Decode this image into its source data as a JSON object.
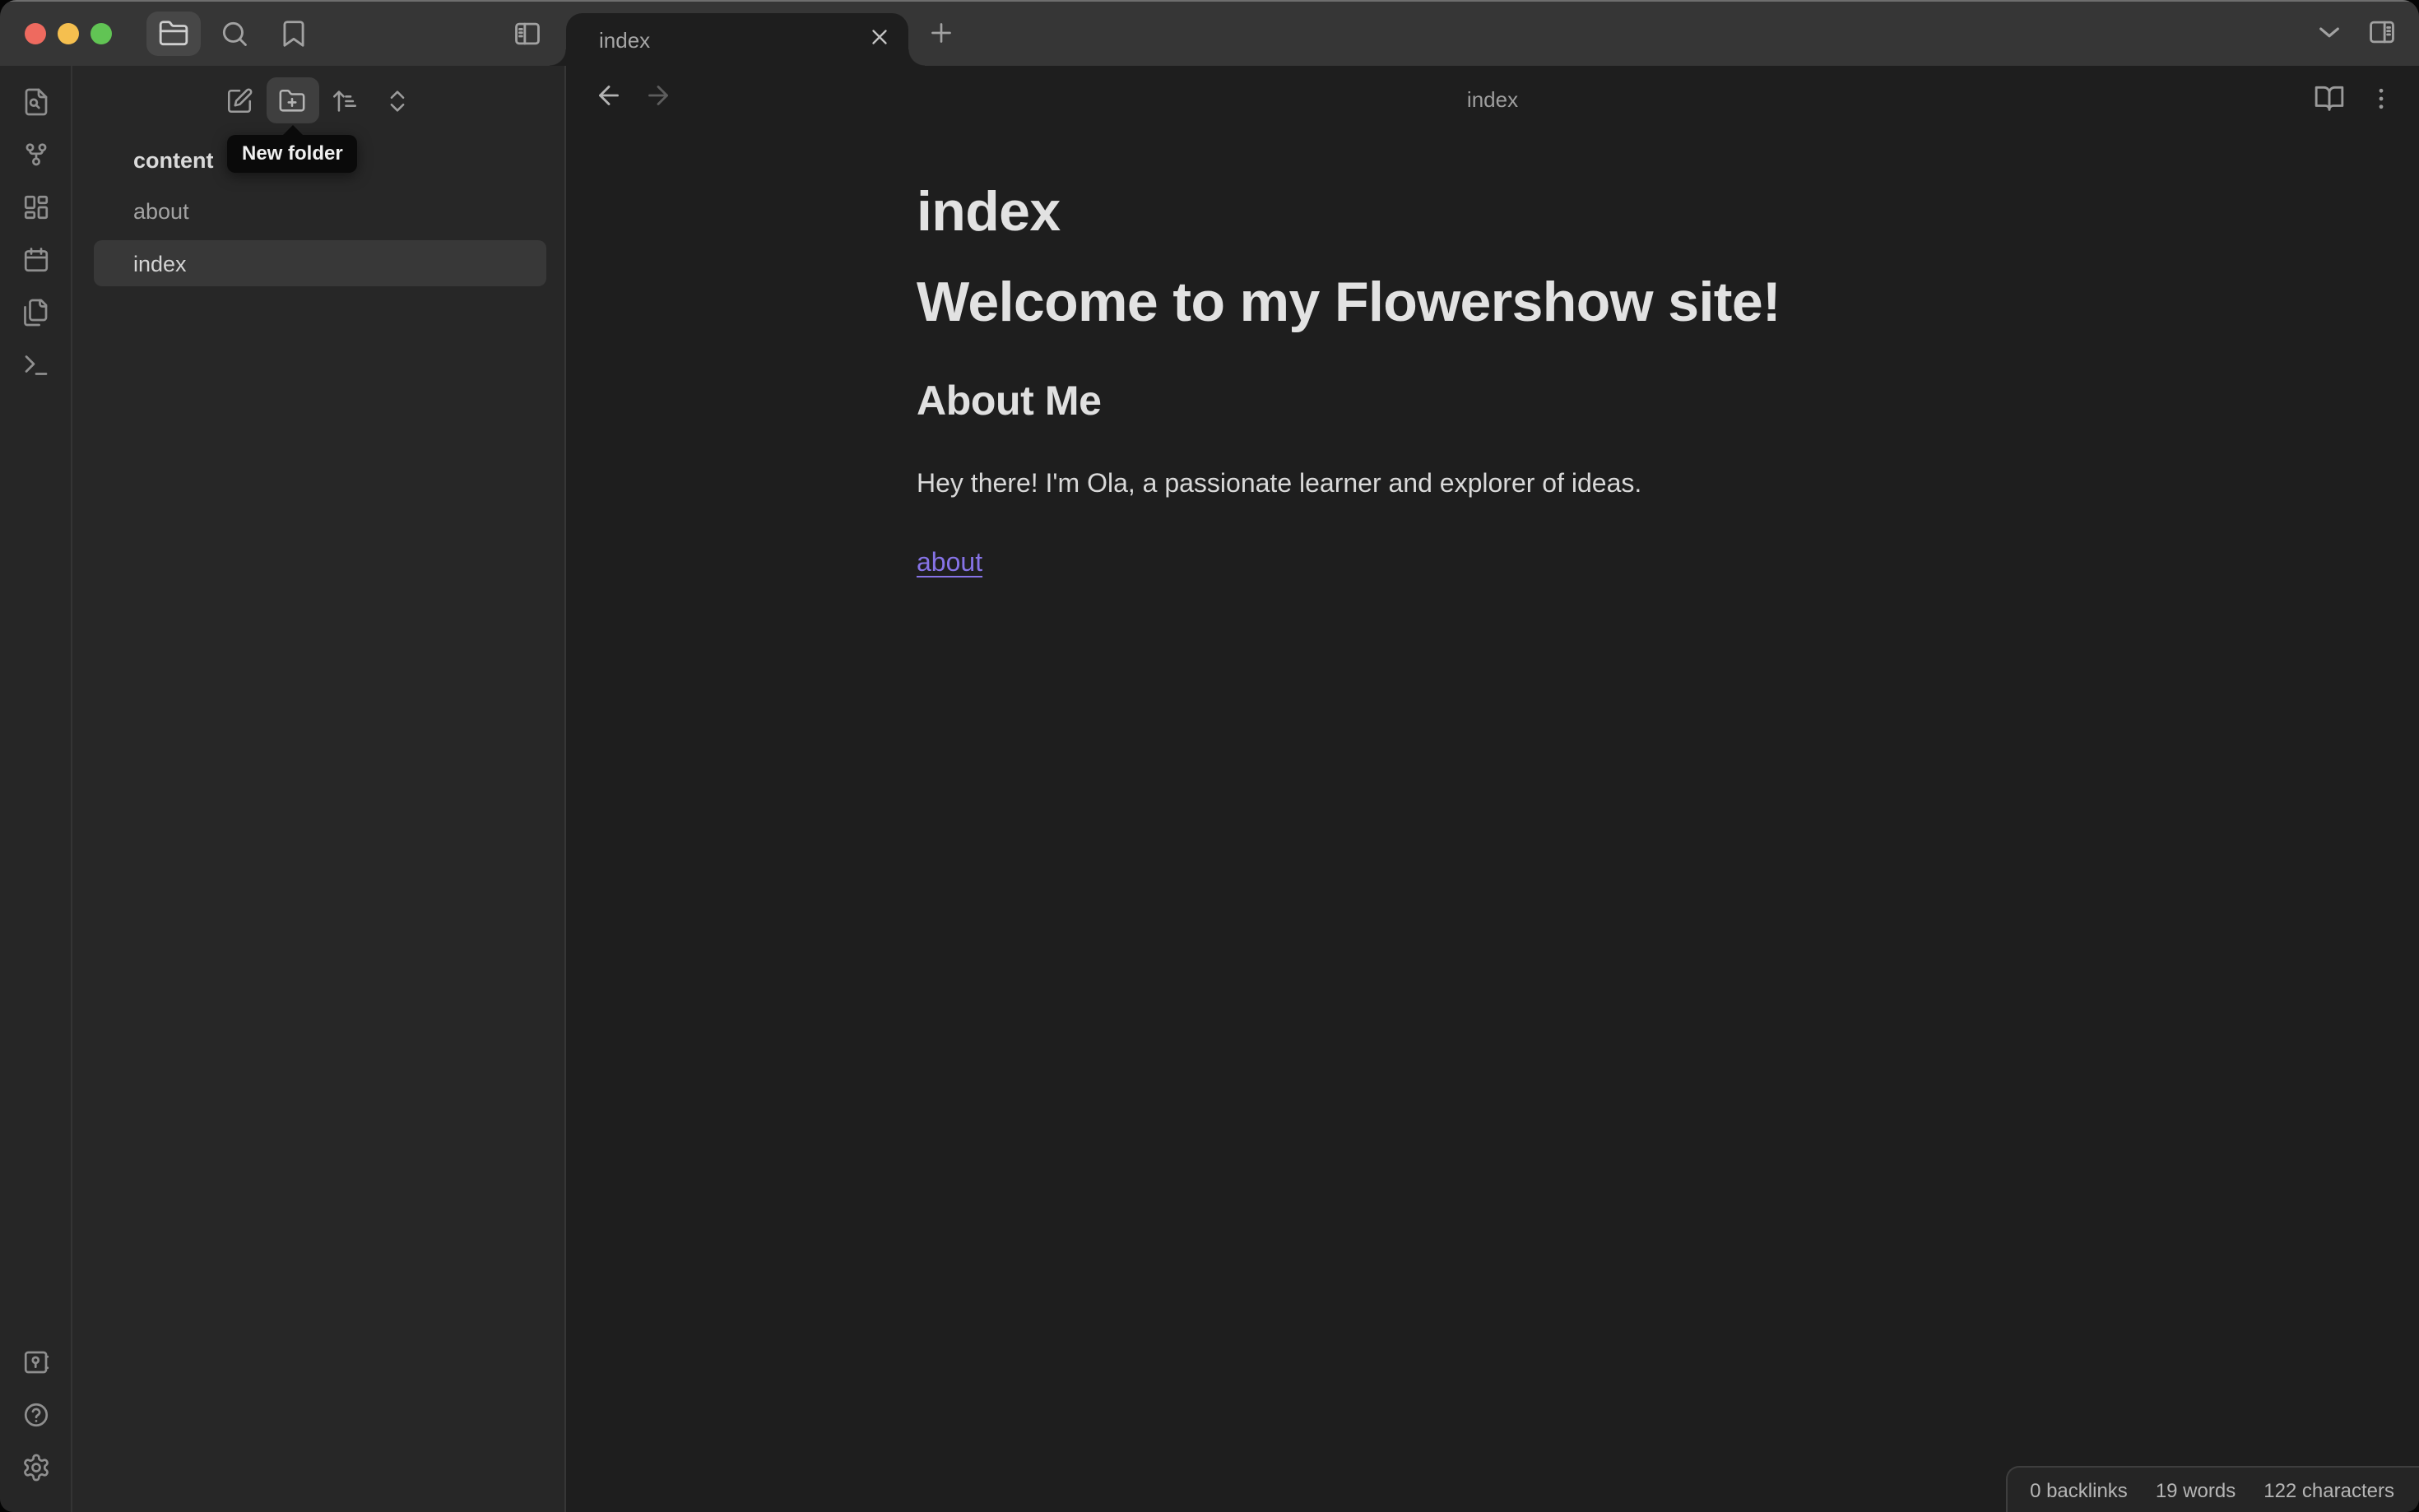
{
  "colors": {
    "titlebar_bg": "#363636",
    "sidebar_bg": "#272727",
    "editor_bg": "#1e1e1e",
    "selected_item_bg": "#383838",
    "tooltip_bg": "#0a0a0a",
    "accent_link": "#8673e6",
    "traffic_red": "#ee6a5f",
    "traffic_yellow": "#f5bf4f",
    "traffic_green": "#61c454"
  },
  "titlebar": {
    "tab_title": "index",
    "icons_left": [
      "folder-icon",
      "search-icon",
      "bookmark-icon",
      "panel-left-toggle-icon"
    ],
    "icons_right": [
      "chevron-down-icon",
      "panel-right-toggle-icon"
    ]
  },
  "ribbon": {
    "top_icons": [
      "file-search-icon",
      "graph-icon",
      "canvas-icon",
      "calendar-icon",
      "templates-icon",
      "terminal-icon"
    ],
    "bottom_icons": [
      "vault-icon",
      "help-icon",
      "settings-icon"
    ]
  },
  "file_explorer": {
    "action_icons": [
      "new-note-icon",
      "new-folder-icon",
      "sort-icon",
      "collapse-all-icon"
    ],
    "tooltip": "New folder",
    "tree": [
      {
        "label": "content",
        "kind": "folder",
        "selected": false
      },
      {
        "label": "about",
        "kind": "file",
        "selected": false
      },
      {
        "label": "index",
        "kind": "file",
        "selected": true
      }
    ]
  },
  "view": {
    "header_title": "index",
    "document": {
      "inline_title": "index",
      "heading1": "Welcome to my Flowershow site!",
      "heading2": "About Me",
      "paragraph": "Hey there! I'm Ola, a passionate learner and explorer of ideas.",
      "link_text": "about"
    }
  },
  "status_bar": {
    "items": [
      "0 backlinks",
      "19 words",
      "122 characters"
    ]
  }
}
